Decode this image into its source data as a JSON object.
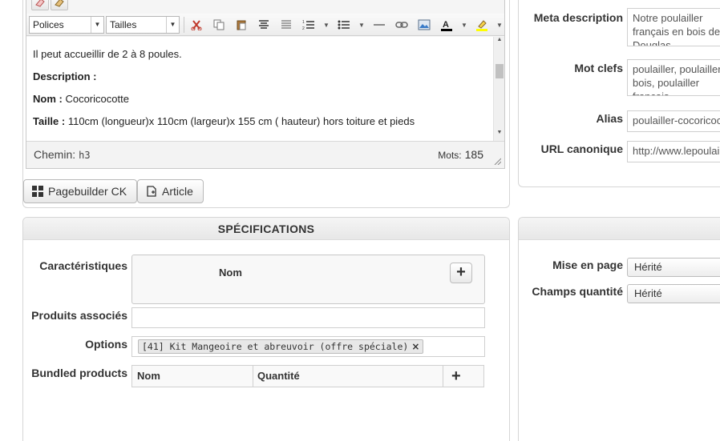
{
  "editor": {
    "toolbar": {
      "fonts_label": "Polices",
      "sizes_label": "Tailles"
    },
    "content": [
      {
        "bold": "",
        "text": "Il peut accueillir de 2 à 8 poules."
      },
      {
        "bold": "Description :",
        "text": ""
      },
      {
        "bold": "Nom :",
        "text": " Cocoricocotte"
      },
      {
        "bold": "Taille :",
        "text": " 110cm (longueur)x 110cm (largeur)x 155 cm ( hauteur) hors toiture et pieds"
      }
    ],
    "status": {
      "path_label": "Chemin:",
      "path_tag": "h3",
      "words_label": "Mots:",
      "words_count": "185"
    }
  },
  "buttons": {
    "pagebuilder": "Pagebuilder CK",
    "article": "Article"
  },
  "seo": {
    "meta_description_label": "Meta description",
    "meta_description_value": "Notre poulailler français en bois de Douglas naturellement imputrescible",
    "keywords_label": "Mot clefs",
    "keywords_value": "poulailler, poulailler bois, poulailler français, Cocoricocotte",
    "alias_label": "Alias",
    "alias_value": "poulailler-cocoricocotte",
    "canonical_label": "URL canonique",
    "canonical_value": "http://www.lepoulailler.fr"
  },
  "specs": {
    "title": "SPÉCIFICATIONS",
    "characteristics_label": "Caractéristiques",
    "characteristics_col": "Nom",
    "related_label": "Produits associés",
    "options_label": "Options",
    "option_chip": "[41] Kit Mangeoire et abreuvoir (offre spéciale)",
    "bundled_label": "Bundled products",
    "bundled_cols": [
      "Nom",
      "Quantité"
    ]
  },
  "side": {
    "layout_label": "Mise en page",
    "layout_value": "Hérité",
    "qty_label": "Champs quantité",
    "qty_value": "Hérité"
  }
}
